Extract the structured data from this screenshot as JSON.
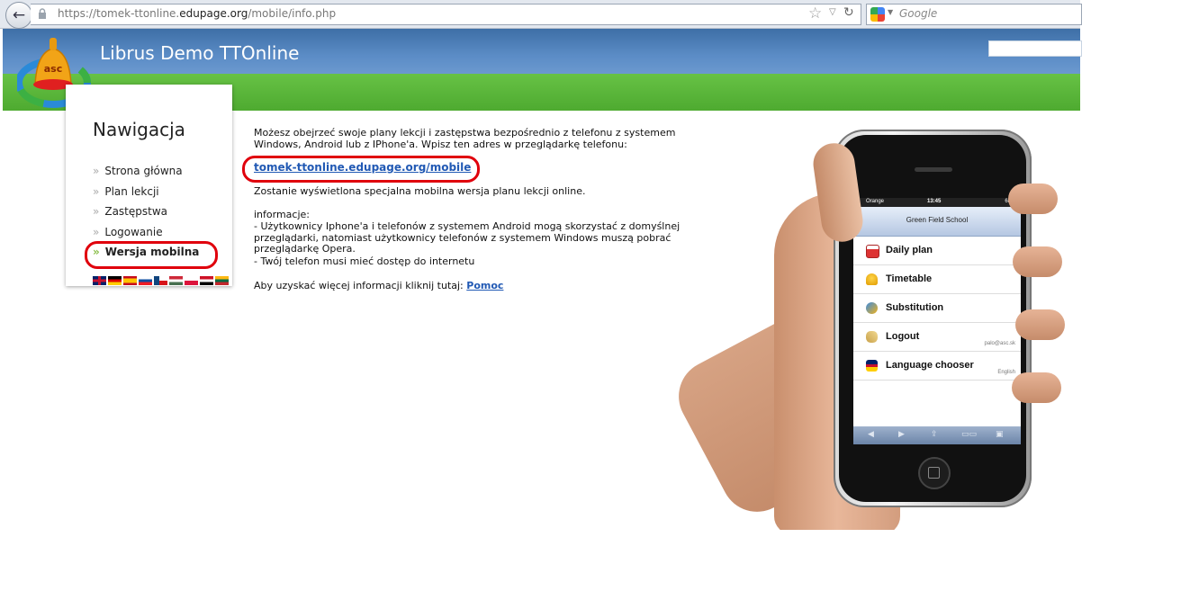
{
  "browser": {
    "url_prefix": "https://tomek-ttonline.",
    "url_domain": "edupage.org",
    "url_path": "/mobile/info.php",
    "search_placeholder": "Google"
  },
  "header": {
    "title": "Librus Demo TTOnline",
    "logo_text": "asc"
  },
  "sidebar": {
    "title": "Nawigacja",
    "items": [
      {
        "label": "Strona główna"
      },
      {
        "label": "Plan lekcji"
      },
      {
        "label": "Zastępstwa"
      },
      {
        "label": "Logowanie"
      },
      {
        "label": "Wersja mobilna"
      }
    ],
    "flags": [
      "gb",
      "de",
      "es",
      "sk",
      "cz",
      "hu",
      "pl",
      "eg",
      "lt"
    ]
  },
  "content": {
    "intro": "Możesz obejrzeć swoje plany lekcji i zastępstwa bezpośrednio z telefonu z systemem Windows, Android lub z IPhone'a. Wpisz ten adres w przeglądarkę telefonu:",
    "mobile_link": "tomek-ttonline.edupage.org/mobile",
    "desc": "Zostanie wyświetlona specjalna mobilna wersja planu lekcji online.",
    "info_head": "informacje:",
    "info_1": "- Użytkownicy Iphone'a i telefonów z systemem Android mogą skorzystać z domyślnej przeglądarki, natomiast użytkownicy telefonów z systemem Windows muszą pobrać przeglądarkę Opera.",
    "info_2": "- Twój telefon musi mieć dostęp do internetu",
    "help_text": "Aby uzyskać więcej informacji kliknij tutaj: ",
    "help_link": "Pomoc"
  },
  "phone": {
    "carrier": "Orange",
    "clock": "13:45",
    "battery": "68 %",
    "school": "Green Field School",
    "menu": [
      {
        "label": "Daily plan",
        "sub": ""
      },
      {
        "label": "Timetable",
        "sub": ""
      },
      {
        "label": "Substitution",
        "sub": ""
      },
      {
        "label": "Logout",
        "sub": "palo@asc.sk"
      },
      {
        "label": "Language chooser",
        "sub": "English"
      }
    ]
  },
  "colors": {
    "header_blue": "#4f80ba",
    "header_green": "#5bb63b",
    "link": "#2159b4",
    "highlight": "#e0000c"
  }
}
